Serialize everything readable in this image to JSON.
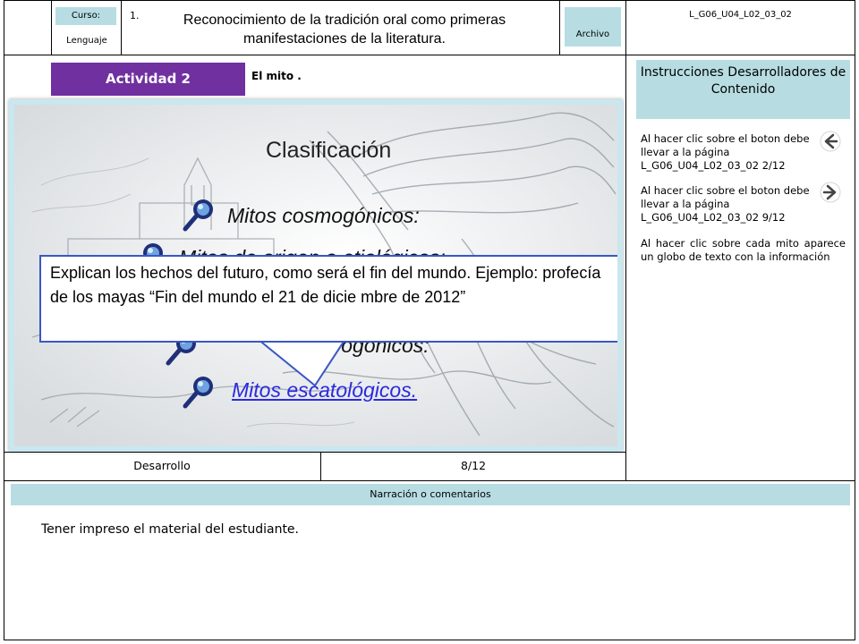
{
  "header": {
    "curso_label": "Curso:",
    "curso_value": "Lenguaje",
    "number": "1.",
    "title": "Reconocimiento de la tradición oral como primeras manifestaciones de la literatura.",
    "archivo_label": "Archivo",
    "code": "L_G06_U04_L02_03_02"
  },
  "activity": {
    "label": "Actividad 2",
    "topic": "El mito ."
  },
  "slide": {
    "heading": "Clasificación",
    "myths": [
      {
        "label": "Mitos cosmogónicos:"
      },
      {
        "label": "Mitos de origen o etiológicos:"
      },
      {
        "label": "antropogónicos:"
      },
      {
        "label": "Mitos escatológicos."
      }
    ],
    "bubble_text": "Explican los hechos del futuro, como será el fin del mundo. Ejemplo: profecía de los mayas “Fin del mundo el 21 de dicie mbre de 2012”",
    "colors": {
      "link": "#2a2ae0",
      "frame": "#c9e7ee",
      "bubble_border": "#3b57c4"
    }
  },
  "instructions": {
    "header": "Instrucciones Desarrolladores de Contenido",
    "items": [
      {
        "text": "Al hacer clic sobre el boton debe llevar a la página L_G06_U04_L02_03_02 2/12",
        "icon": "arrow-left-icon"
      },
      {
        "text": "Al hacer clic sobre el boton debe llevar a la página L_G06_U04_L02_03_02 9/12",
        "icon": "arrow-right-icon"
      },
      {
        "text": "Al hacer clic sobre cada mito aparece un globo de texto con la información"
      }
    ]
  },
  "footer_row": {
    "section": "Desarrollo",
    "page": "8/12"
  },
  "narration": {
    "header": "Narración o comentarios",
    "text": "Tener impreso el material del estudiante."
  }
}
